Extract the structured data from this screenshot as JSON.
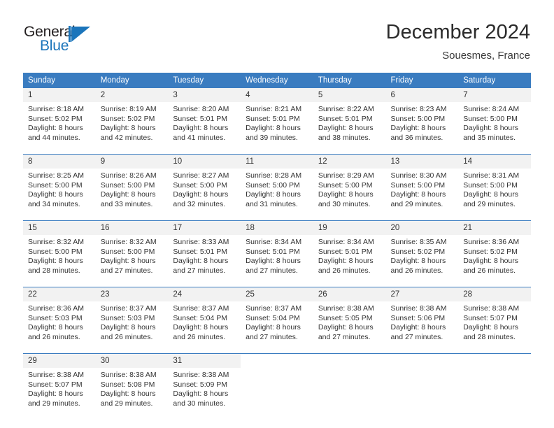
{
  "logo": {
    "text_top": "General",
    "text_bottom": "Blue",
    "accent_color": "#1b75bb"
  },
  "header": {
    "title": "December 2024",
    "subtitle": "Souesmes, France"
  },
  "calendar": {
    "header_color": "#3a7cc0",
    "weekday_headers": [
      "Sunday",
      "Monday",
      "Tuesday",
      "Wednesday",
      "Thursday",
      "Friday",
      "Saturday"
    ],
    "weeks": [
      [
        {
          "day": "1",
          "sunrise": "Sunrise: 8:18 AM",
          "sunset": "Sunset: 5:02 PM",
          "daylight_1": "Daylight: 8 hours",
          "daylight_2": "and 44 minutes."
        },
        {
          "day": "2",
          "sunrise": "Sunrise: 8:19 AM",
          "sunset": "Sunset: 5:02 PM",
          "daylight_1": "Daylight: 8 hours",
          "daylight_2": "and 42 minutes."
        },
        {
          "day": "3",
          "sunrise": "Sunrise: 8:20 AM",
          "sunset": "Sunset: 5:01 PM",
          "daylight_1": "Daylight: 8 hours",
          "daylight_2": "and 41 minutes."
        },
        {
          "day": "4",
          "sunrise": "Sunrise: 8:21 AM",
          "sunset": "Sunset: 5:01 PM",
          "daylight_1": "Daylight: 8 hours",
          "daylight_2": "and 39 minutes."
        },
        {
          "day": "5",
          "sunrise": "Sunrise: 8:22 AM",
          "sunset": "Sunset: 5:01 PM",
          "daylight_1": "Daylight: 8 hours",
          "daylight_2": "and 38 minutes."
        },
        {
          "day": "6",
          "sunrise": "Sunrise: 8:23 AM",
          "sunset": "Sunset: 5:00 PM",
          "daylight_1": "Daylight: 8 hours",
          "daylight_2": "and 36 minutes."
        },
        {
          "day": "7",
          "sunrise": "Sunrise: 8:24 AM",
          "sunset": "Sunset: 5:00 PM",
          "daylight_1": "Daylight: 8 hours",
          "daylight_2": "and 35 minutes."
        }
      ],
      [
        {
          "day": "8",
          "sunrise": "Sunrise: 8:25 AM",
          "sunset": "Sunset: 5:00 PM",
          "daylight_1": "Daylight: 8 hours",
          "daylight_2": "and 34 minutes."
        },
        {
          "day": "9",
          "sunrise": "Sunrise: 8:26 AM",
          "sunset": "Sunset: 5:00 PM",
          "daylight_1": "Daylight: 8 hours",
          "daylight_2": "and 33 minutes."
        },
        {
          "day": "10",
          "sunrise": "Sunrise: 8:27 AM",
          "sunset": "Sunset: 5:00 PM",
          "daylight_1": "Daylight: 8 hours",
          "daylight_2": "and 32 minutes."
        },
        {
          "day": "11",
          "sunrise": "Sunrise: 8:28 AM",
          "sunset": "Sunset: 5:00 PM",
          "daylight_1": "Daylight: 8 hours",
          "daylight_2": "and 31 minutes."
        },
        {
          "day": "12",
          "sunrise": "Sunrise: 8:29 AM",
          "sunset": "Sunset: 5:00 PM",
          "daylight_1": "Daylight: 8 hours",
          "daylight_2": "and 30 minutes."
        },
        {
          "day": "13",
          "sunrise": "Sunrise: 8:30 AM",
          "sunset": "Sunset: 5:00 PM",
          "daylight_1": "Daylight: 8 hours",
          "daylight_2": "and 29 minutes."
        },
        {
          "day": "14",
          "sunrise": "Sunrise: 8:31 AM",
          "sunset": "Sunset: 5:00 PM",
          "daylight_1": "Daylight: 8 hours",
          "daylight_2": "and 29 minutes."
        }
      ],
      [
        {
          "day": "15",
          "sunrise": "Sunrise: 8:32 AM",
          "sunset": "Sunset: 5:00 PM",
          "daylight_1": "Daylight: 8 hours",
          "daylight_2": "and 28 minutes."
        },
        {
          "day": "16",
          "sunrise": "Sunrise: 8:32 AM",
          "sunset": "Sunset: 5:00 PM",
          "daylight_1": "Daylight: 8 hours",
          "daylight_2": "and 27 minutes."
        },
        {
          "day": "17",
          "sunrise": "Sunrise: 8:33 AM",
          "sunset": "Sunset: 5:01 PM",
          "daylight_1": "Daylight: 8 hours",
          "daylight_2": "and 27 minutes."
        },
        {
          "day": "18",
          "sunrise": "Sunrise: 8:34 AM",
          "sunset": "Sunset: 5:01 PM",
          "daylight_1": "Daylight: 8 hours",
          "daylight_2": "and 27 minutes."
        },
        {
          "day": "19",
          "sunrise": "Sunrise: 8:34 AM",
          "sunset": "Sunset: 5:01 PM",
          "daylight_1": "Daylight: 8 hours",
          "daylight_2": "and 26 minutes."
        },
        {
          "day": "20",
          "sunrise": "Sunrise: 8:35 AM",
          "sunset": "Sunset: 5:02 PM",
          "daylight_1": "Daylight: 8 hours",
          "daylight_2": "and 26 minutes."
        },
        {
          "day": "21",
          "sunrise": "Sunrise: 8:36 AM",
          "sunset": "Sunset: 5:02 PM",
          "daylight_1": "Daylight: 8 hours",
          "daylight_2": "and 26 minutes."
        }
      ],
      [
        {
          "day": "22",
          "sunrise": "Sunrise: 8:36 AM",
          "sunset": "Sunset: 5:03 PM",
          "daylight_1": "Daylight: 8 hours",
          "daylight_2": "and 26 minutes."
        },
        {
          "day": "23",
          "sunrise": "Sunrise: 8:37 AM",
          "sunset": "Sunset: 5:03 PM",
          "daylight_1": "Daylight: 8 hours",
          "daylight_2": "and 26 minutes."
        },
        {
          "day": "24",
          "sunrise": "Sunrise: 8:37 AM",
          "sunset": "Sunset: 5:04 PM",
          "daylight_1": "Daylight: 8 hours",
          "daylight_2": "and 26 minutes."
        },
        {
          "day": "25",
          "sunrise": "Sunrise: 8:37 AM",
          "sunset": "Sunset: 5:04 PM",
          "daylight_1": "Daylight: 8 hours",
          "daylight_2": "and 27 minutes."
        },
        {
          "day": "26",
          "sunrise": "Sunrise: 8:38 AM",
          "sunset": "Sunset: 5:05 PM",
          "daylight_1": "Daylight: 8 hours",
          "daylight_2": "and 27 minutes."
        },
        {
          "day": "27",
          "sunrise": "Sunrise: 8:38 AM",
          "sunset": "Sunset: 5:06 PM",
          "daylight_1": "Daylight: 8 hours",
          "daylight_2": "and 27 minutes."
        },
        {
          "day": "28",
          "sunrise": "Sunrise: 8:38 AM",
          "sunset": "Sunset: 5:07 PM",
          "daylight_1": "Daylight: 8 hours",
          "daylight_2": "and 28 minutes."
        }
      ],
      [
        {
          "day": "29",
          "sunrise": "Sunrise: 8:38 AM",
          "sunset": "Sunset: 5:07 PM",
          "daylight_1": "Daylight: 8 hours",
          "daylight_2": "and 29 minutes."
        },
        {
          "day": "30",
          "sunrise": "Sunrise: 8:38 AM",
          "sunset": "Sunset: 5:08 PM",
          "daylight_1": "Daylight: 8 hours",
          "daylight_2": "and 29 minutes."
        },
        {
          "day": "31",
          "sunrise": "Sunrise: 8:38 AM",
          "sunset": "Sunset: 5:09 PM",
          "daylight_1": "Daylight: 8 hours",
          "daylight_2": "and 30 minutes."
        },
        {
          "day": "",
          "sunrise": "",
          "sunset": "",
          "daylight_1": "",
          "daylight_2": ""
        },
        {
          "day": "",
          "sunrise": "",
          "sunset": "",
          "daylight_1": "",
          "daylight_2": ""
        },
        {
          "day": "",
          "sunrise": "",
          "sunset": "",
          "daylight_1": "",
          "daylight_2": ""
        },
        {
          "day": "",
          "sunrise": "",
          "sunset": "",
          "daylight_1": "",
          "daylight_2": ""
        }
      ]
    ]
  }
}
